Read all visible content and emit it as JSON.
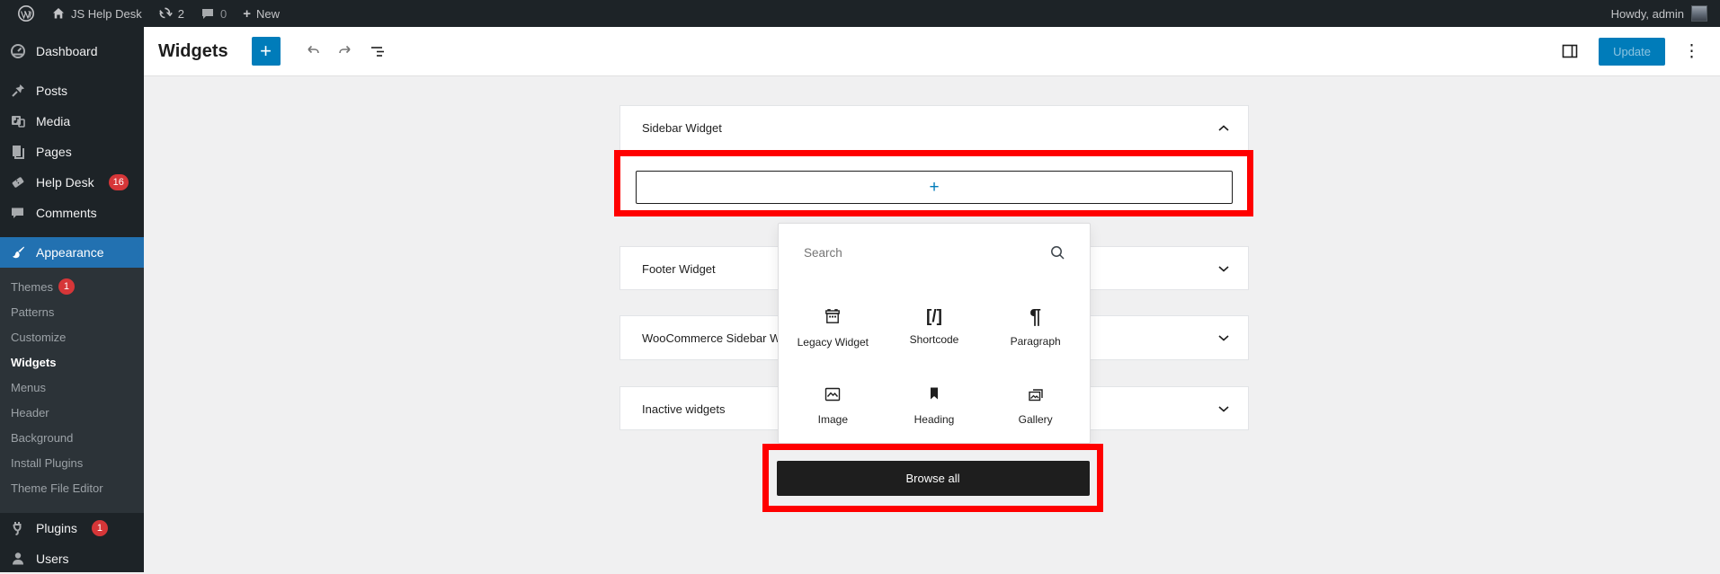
{
  "admin_bar": {
    "site_name": "JS Help Desk",
    "updates_count": "2",
    "comments_count": "0",
    "new_label": "New",
    "greeting": "Howdy, admin"
  },
  "sidebar": {
    "items": [
      {
        "label": "Dashboard"
      },
      {
        "label": "Posts"
      },
      {
        "label": "Media"
      },
      {
        "label": "Pages"
      },
      {
        "label": "Help Desk",
        "badge": "16"
      },
      {
        "label": "Comments"
      },
      {
        "label": "Appearance"
      },
      {
        "label": "Plugins",
        "badge": "1"
      },
      {
        "label": "Users"
      }
    ],
    "appearance_submenu": [
      {
        "label": "Themes",
        "badge": "1"
      },
      {
        "label": "Patterns"
      },
      {
        "label": "Customize"
      },
      {
        "label": "Widgets",
        "active": true
      },
      {
        "label": "Menus"
      },
      {
        "label": "Header"
      },
      {
        "label": "Background"
      },
      {
        "label": "Install Plugins"
      },
      {
        "label": "Theme File Editor"
      }
    ]
  },
  "editor_header": {
    "title": "Widgets",
    "update_label": "Update"
  },
  "widget_areas": [
    {
      "title": "Sidebar Widget",
      "state": "expanded"
    },
    {
      "title": "Footer Widget",
      "state": "collapsed"
    },
    {
      "title": "WooCommerce Sidebar Wi",
      "state": "collapsed"
    },
    {
      "title": "Inactive widgets",
      "state": "collapsed"
    }
  ],
  "inserter": {
    "search_placeholder": "Search",
    "blocks": [
      {
        "label": "Legacy Widget",
        "icon": "legacy-widget-icon"
      },
      {
        "label": "Shortcode",
        "icon": "shortcode-icon"
      },
      {
        "label": "Paragraph",
        "icon": "paragraph-icon"
      },
      {
        "label": "Image",
        "icon": "image-icon"
      },
      {
        "label": "Heading",
        "icon": "heading-icon"
      },
      {
        "label": "Gallery",
        "icon": "gallery-icon"
      }
    ],
    "browse_all_label": "Browse all"
  },
  "icons": {
    "shortcode_glyph": "[/]",
    "paragraph_glyph": "¶",
    "kebab_glyph": "⋮",
    "add_glyph": "+"
  },
  "colors": {
    "accent_blue": "#007cba",
    "menu_highlight_blue": "#2271b1",
    "badge_red": "#d63638",
    "annotation_red": "#ff0000",
    "dark_button": "#1e1e1e",
    "admin_dark": "#1d2327"
  }
}
